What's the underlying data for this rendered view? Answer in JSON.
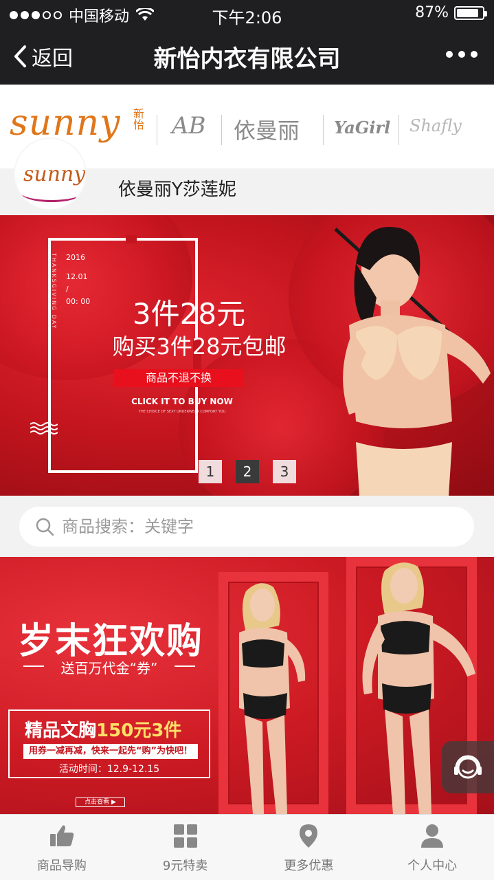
{
  "status_bar": {
    "carrier": "中国移动",
    "time": "下午2:06",
    "battery": "87%",
    "battery_level": 0.87
  },
  "navbar": {
    "back_label": "返回",
    "title": "新怡内衣有限公司"
  },
  "brand_strip": {
    "main_logo": "sunny",
    "main_logo_suffix": "新怡",
    "brands": [
      "AB",
      "依曼丽",
      "YaGirl",
      "Shafly"
    ]
  },
  "profile": {
    "avatar_text": "sunny",
    "shop_name": "依曼丽Y莎莲妮"
  },
  "banner1": {
    "date_lines": [
      "2016",
      "12.01",
      "/",
      "00: 00"
    ],
    "vertical_text": "THANKSGIVING DAY",
    "headline": "3件28元",
    "subhead": "购买3件28元包邮",
    "tag": "商品不退不换",
    "cta": "CLICK IT TO BUY NOW",
    "cta_sub": "THE CHOICE OF SEXY UNDERWEAR COMFORT YOU",
    "pager": [
      "1",
      "2",
      "3"
    ],
    "active_page": 2
  },
  "search": {
    "placeholder": "商品搜索：关键字"
  },
  "banner2": {
    "title": "岁末狂欢购",
    "subtitle": "送百万代金“券”",
    "promo_prefix": "精品文胸",
    "promo_highlight": "150元3件",
    "promo_line2": "用券一减再减，快来一起先“购”为快吧！",
    "promo_time": "活动时间：12.9-12.15",
    "button": "点击查看 ▶"
  },
  "tabbar": {
    "items": [
      {
        "label": "商品导购",
        "icon": "thumbs-up-icon"
      },
      {
        "label": "9元特卖",
        "icon": "grid-icon"
      },
      {
        "label": "更多优惠",
        "icon": "location-pin-icon"
      },
      {
        "label": "个人中心",
        "icon": "user-icon"
      }
    ]
  }
}
